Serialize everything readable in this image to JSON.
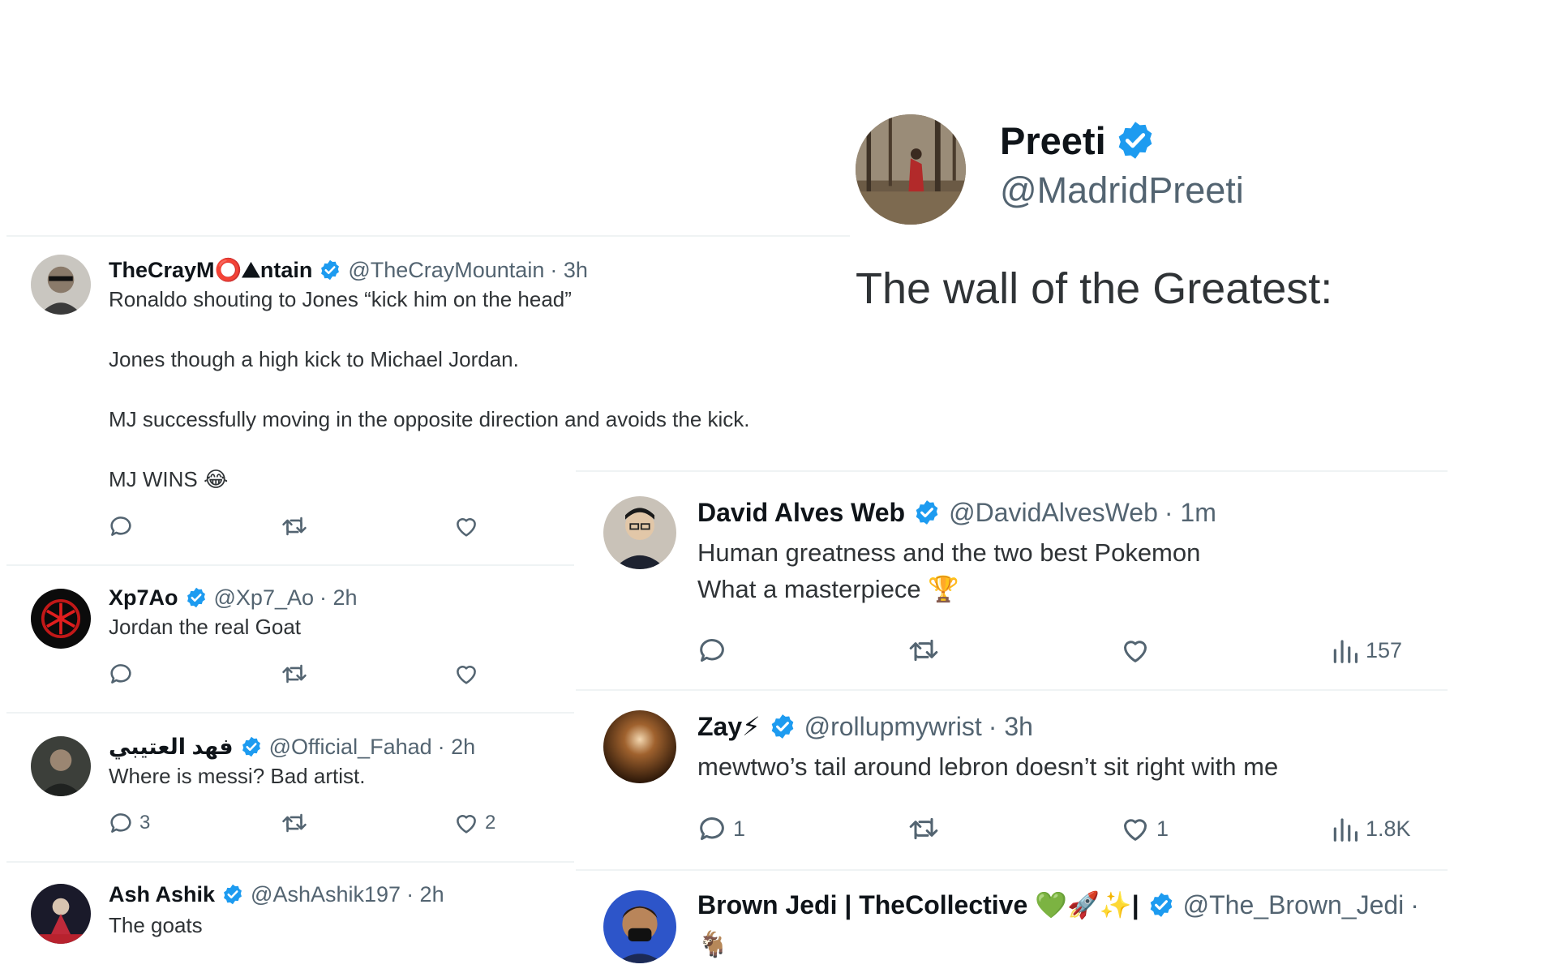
{
  "header_post": {
    "name": "Preeti",
    "handle": "@MadridPreeti",
    "text": "The wall of the Greatest:"
  },
  "left_replies": [
    {
      "name": "TheCrayM⭕⛰ntain",
      "handle": "@TheCrayMountain",
      "time": "· 3h",
      "lines": [
        "Ronaldo shouting to Jones “kick him on the head”",
        "Jones though a high kick to Michael Jordan.",
        "MJ successfully moving in the opposite direction and avoids the kick.",
        "MJ WINS 😂"
      ],
      "replies": "",
      "likes": ""
    },
    {
      "name": "Xp7Ao",
      "handle": "@Xp7_Ao",
      "time": "· 2h",
      "lines": [
        "Jordan the real Goat"
      ],
      "replies": "",
      "likes": ""
    },
    {
      "name": "فهد العتيبي",
      "handle": "@Official_Fahad",
      "time": "· 2h",
      "lines": [
        "Where is messi? Bad artist."
      ],
      "replies": "3",
      "likes": "2"
    },
    {
      "name": "Ash Ashik",
      "handle": "@AshAshik197",
      "time": "· 2h",
      "lines": [
        "The goats"
      ]
    }
  ],
  "right_replies": [
    {
      "name": "David Alves Web",
      "handle": "@DavidAlvesWeb",
      "time": "· 1m",
      "lines": [
        "Human greatness and the two best Pokemon",
        "What a masterpiece 🏆"
      ],
      "replies": "",
      "likes": "",
      "views": "157"
    },
    {
      "name": "Zay⚡",
      "handle": "@rollupmywrist",
      "time": "· 3h",
      "lines": [
        "mewtwo’s tail around lebron doesn’t sit right with me"
      ],
      "replies": "1",
      "likes": "1",
      "views": "1.8K"
    },
    {
      "name": "Brown Jedi | TheCollective 💚🚀✨|",
      "handle": "@The_Brown_Jedi",
      "time": "·",
      "lines": [
        "🐐"
      ]
    }
  ],
  "icons": {
    "reply": "speech-bubble-icon",
    "retweet": "repost-arrows-icon",
    "like": "heart-icon",
    "views": "bar-chart-icon",
    "verified": "verified-badge-icon"
  },
  "colors": {
    "verified_blue": "#1d9bf0",
    "text_primary": "#0f1419",
    "text_secondary": "#536471",
    "divider": "#eff3f4"
  }
}
